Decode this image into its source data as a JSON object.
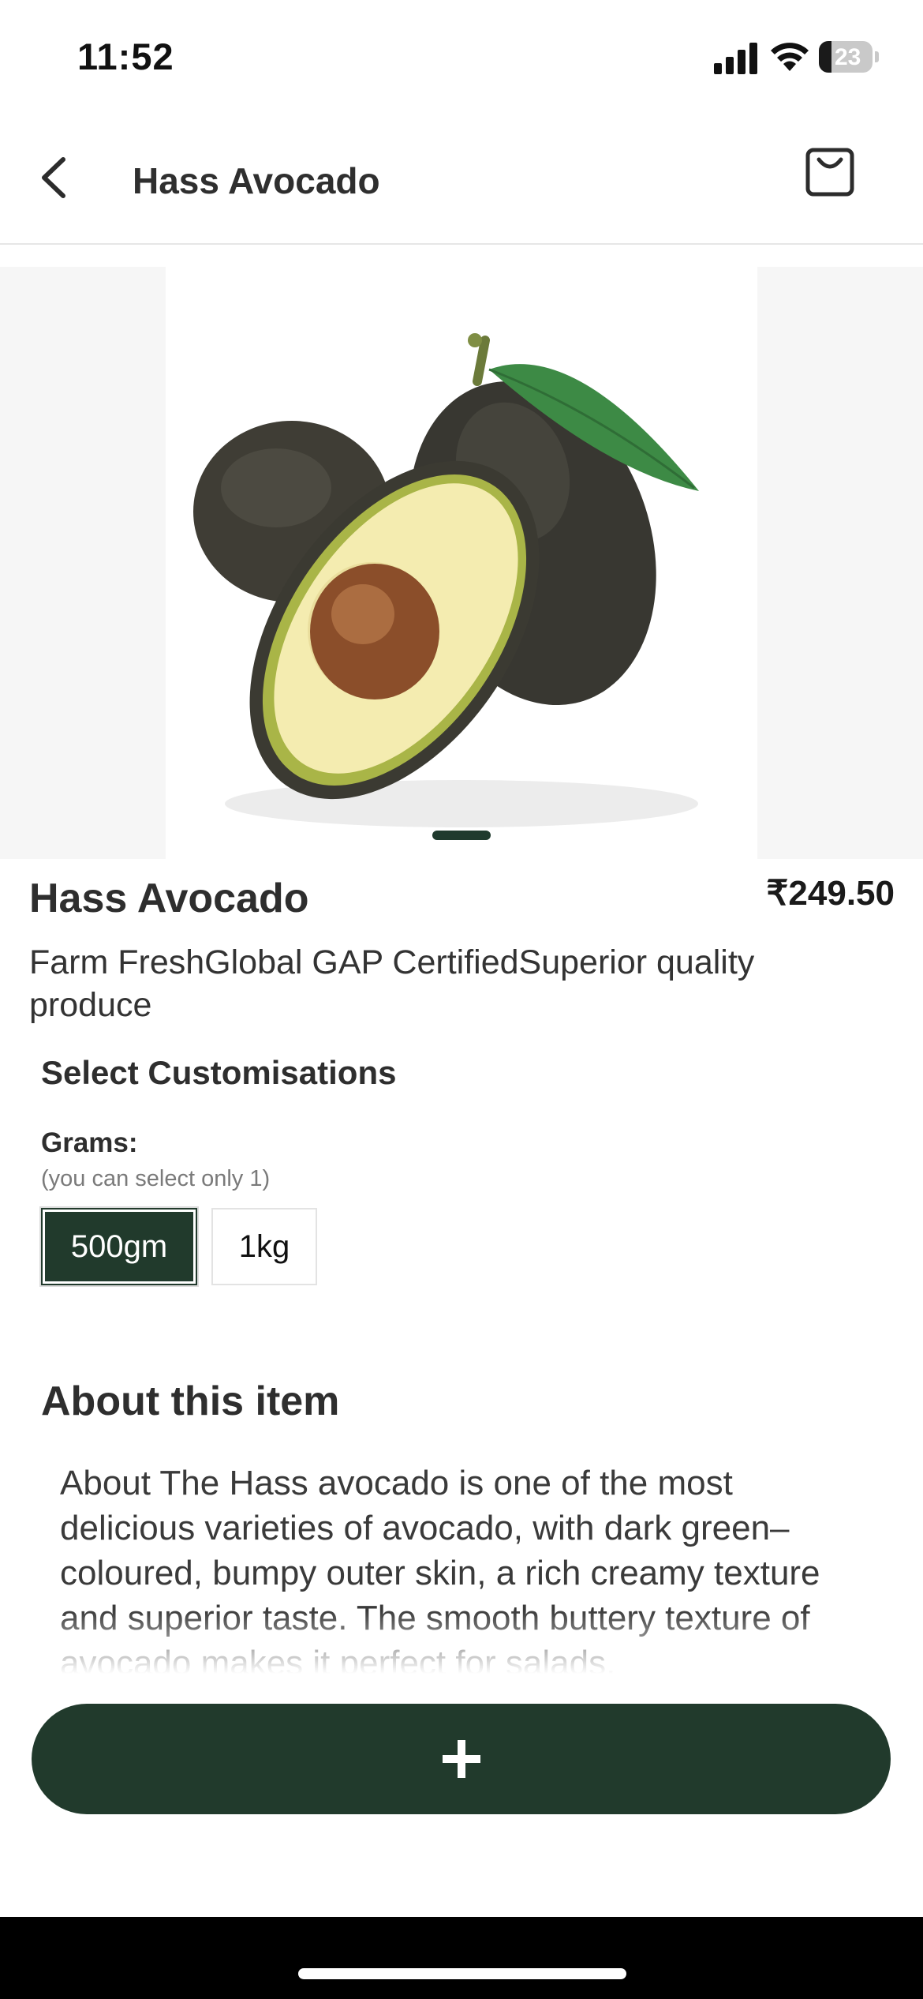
{
  "status_bar": {
    "time": "11:52",
    "battery": "23",
    "battery_level": 0.23
  },
  "header": {
    "title": "Hass Avocado",
    "back_icon": "chevron-left-icon",
    "cart_icon": "shopping-bag-icon"
  },
  "carousel": {
    "image_alt": "Hass avocado product photo",
    "active_index": 0
  },
  "product": {
    "name": "Hass Avocado",
    "price": "₹249.50",
    "description": "Farm FreshGlobal GAP CertifiedSuperior quality produce"
  },
  "customisation": {
    "title": "Select Customisations",
    "group_label": "Grams:",
    "hint": "(you can select only 1)",
    "options": [
      {
        "label": "500gm",
        "selected": true
      },
      {
        "label": "1kg",
        "selected": false
      }
    ]
  },
  "about": {
    "title": "About this item",
    "text": "About The Hass avocado is one of the most delicious varieties of avocado, with dark green–coloured, bumpy outer skin, a rich creamy texture and superior taste. The smooth buttery texture of avocado makes it perfect for salads,"
  },
  "actions": {
    "add_icon": "plus-icon"
  },
  "colors": {
    "brand_dark_green": "#213a2c",
    "text_dark": "#2e2e2e",
    "hint_gray": "#7a7a7a"
  }
}
